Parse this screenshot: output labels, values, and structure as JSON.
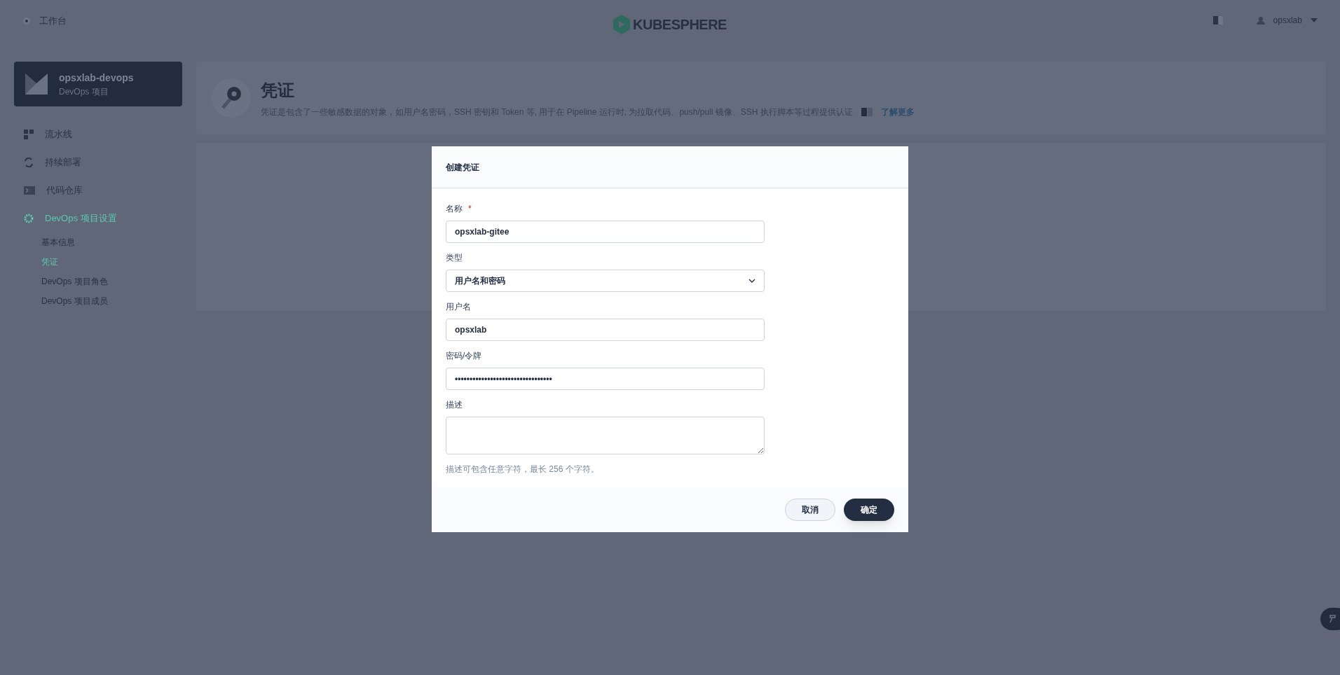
{
  "topbar": {
    "workbench": "工作台",
    "logo": "KUBESPHERE",
    "user": "opsxlab"
  },
  "project": {
    "name": "opsxlab-devops",
    "type": "DevOps 项目"
  },
  "nav": [
    {
      "label": "流水线",
      "selected": false
    },
    {
      "label": "持续部署",
      "selected": false
    },
    {
      "label": "代码仓库",
      "selected": false
    },
    {
      "label": "DevOps 项目设置",
      "selected": true,
      "children": [
        {
          "label": "基本信息",
          "selected": false
        },
        {
          "label": "凭证",
          "selected": true
        },
        {
          "label": "DevOps 项目角色",
          "selected": false
        },
        {
          "label": "DevOps 项目成员",
          "selected": false
        }
      ]
    }
  ],
  "header": {
    "title": "凭证",
    "description": "凭证是包含了一些敏感数据的对象，如用户名密码，SSH 密钥和 Token 等, 用于在 Pipeline 运行时, 为拉取代码、push/pull 镜像、SSH 执行脚本等过程提供认证",
    "learn_more": "了解更多"
  },
  "dialog": {
    "title": "创建凭证",
    "fields": [
      {
        "kind": "input",
        "label": "名称",
        "required_mark": "*",
        "value": "opsxlab-gitee"
      },
      {
        "kind": "select",
        "label": "类型",
        "value": "用户名和密码"
      },
      {
        "kind": "input",
        "label": "用户名",
        "value": "opsxlab"
      },
      {
        "kind": "input",
        "label": "密码/令牌",
        "value": "•••••••••••••••••••••••••••••••••"
      },
      {
        "kind": "textarea",
        "label": "描述"
      }
    ],
    "hint": "描述可包含任意字符，最长 256 个字符。",
    "buttons": [
      {
        "label": "取消",
        "kind": "secondary"
      },
      {
        "label": "确定",
        "kind": "primary"
      }
    ]
  }
}
